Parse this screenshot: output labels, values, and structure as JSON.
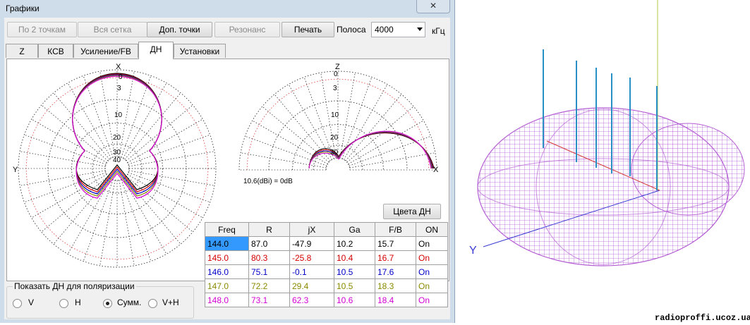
{
  "window": {
    "title": "Графики",
    "close_glyph": "✕"
  },
  "toolbar": {
    "btn_2pts": "По 2 точкам",
    "btn_grid": "Вся сетка",
    "btn_extra": "Доп. точки",
    "btn_res": "Резонанс",
    "btn_print": "Печать",
    "band_label": "Полоса",
    "band_value": "4000",
    "unit": "кГц"
  },
  "tabs": [
    "Z",
    "КСВ",
    "Усиление/FB",
    "ДН",
    "Установки"
  ],
  "plot": {
    "left_top": "X",
    "left_side": "Y",
    "right_top": "Z",
    "right_side": "X",
    "ring_labels": [
      "0",
      "3",
      "10",
      "20",
      "30",
      "40"
    ],
    "ref_text": "10.6(dBi) = 0dB",
    "colors_button": "Цвета ДН"
  },
  "table": {
    "headers": [
      "Freq",
      "R",
      "jX",
      "Ga",
      "F/B",
      "ON"
    ],
    "rows": [
      {
        "cells": [
          "144.0",
          "87.0",
          "-47.9",
          "10.2",
          "15.7",
          "On"
        ],
        "color": "#000000"
      },
      {
        "cells": [
          "145.0",
          "80.3",
          "-25.8",
          "10.4",
          "16.7",
          "On"
        ],
        "color": "#d40000"
      },
      {
        "cells": [
          "146.0",
          "75.1",
          "-0.1",
          "10.5",
          "17.6",
          "On"
        ],
        "color": "#0000c8"
      },
      {
        "cells": [
          "147.0",
          "72.2",
          "29.4",
          "10.5",
          "18.3",
          "On"
        ],
        "color": "#8a8a00"
      },
      {
        "cells": [
          "148.0",
          "73.1",
          "62.3",
          "10.6",
          "18.4",
          "On"
        ],
        "color": "#d400d4"
      }
    ]
  },
  "polarization": {
    "caption": "Показать ДН для поляризации",
    "options": [
      "V",
      "H",
      "Сумм.",
      "V+H"
    ],
    "selected": "Сумм."
  },
  "view3d": {
    "axis_label": "Y",
    "watermark": "radioproffi.ucoz.ua"
  },
  "colors": {
    "selected_cell": "#3399ff",
    "mesh": "#b45fd4"
  }
}
